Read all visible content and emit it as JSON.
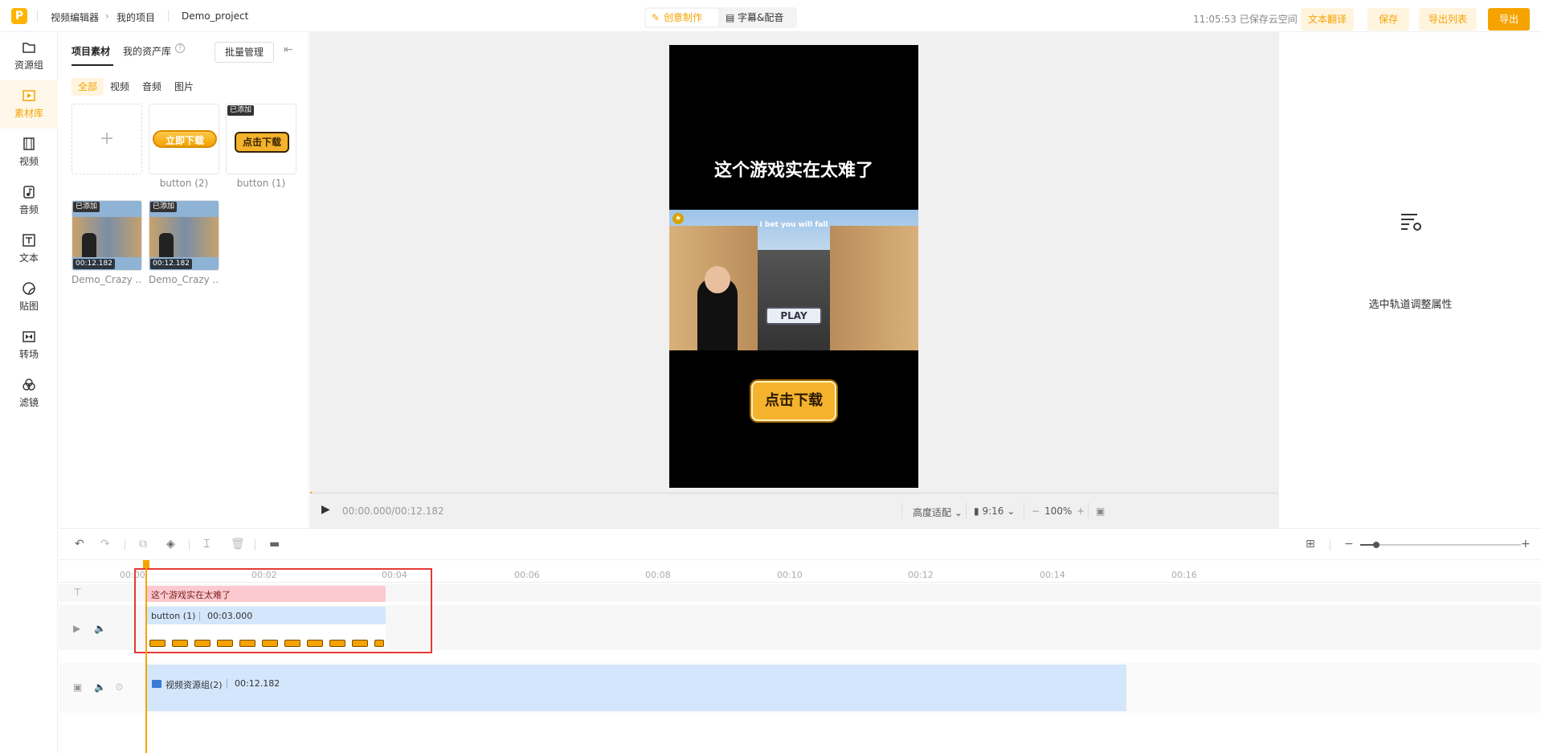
{
  "topbar": {
    "logo": "P",
    "breadcrumb": [
      "视频编辑器",
      "我的项目"
    ],
    "project_name": "Demo_project",
    "modes": [
      {
        "label": "创意制作",
        "icon": "magic-wand-icon"
      },
      {
        "label": "字幕&配音",
        "icon": "subtitle-icon"
      }
    ],
    "save_status": "11:05:53 已保存云空间",
    "buttons": {
      "translate": "文本翻译",
      "save": "保存",
      "export_list": "导出列表",
      "export": "导出"
    }
  },
  "leftnav": [
    {
      "label": "资源组",
      "icon": "folder-icon"
    },
    {
      "label": "素材库",
      "icon": "media-library-icon",
      "active": true
    },
    {
      "label": "视频",
      "icon": "film-icon"
    },
    {
      "label": "音频",
      "icon": "music-icon"
    },
    {
      "label": "文本",
      "icon": "text-icon"
    },
    {
      "label": "贴图",
      "icon": "sticker-icon"
    },
    {
      "label": "转场",
      "icon": "transition-icon"
    },
    {
      "label": "滤镜",
      "icon": "filter-icon"
    }
  ],
  "assets": {
    "tabs": [
      "项目素材",
      "我的资产库"
    ],
    "batch_label": "批量管理",
    "filters": [
      "全部",
      "视频",
      "音频",
      "图片"
    ],
    "items": [
      {
        "name": "button (2)",
        "added": false,
        "graphic_text": "立即下载"
      },
      {
        "name": "button (1)",
        "added": true,
        "badge": "已添加",
        "graphic_text": "点击下载"
      },
      {
        "name": "Demo_Crazy ...",
        "added": true,
        "badge": "已添加",
        "duration": "00:12.182"
      },
      {
        "name": "Demo_Crazy ...",
        "added": true,
        "badge": "已添加",
        "duration": "00:12.182"
      }
    ]
  },
  "preview": {
    "video_title": "这个游戏实在太难了",
    "scene_caption": "I bet you will fall",
    "play_label": "PLAY",
    "download_button": "点击下载",
    "time": "00:00.000/00:12.182",
    "fit_mode": "高度适配",
    "ratio": "9:16",
    "zoom": "100%"
  },
  "props": {
    "hint": "选中轨道调整属性",
    "icon": "settings-list-icon"
  },
  "timeline": {
    "ruler": [
      "00:00",
      "00:02",
      "00:04",
      "00:06",
      "00:08",
      "00:10",
      "00:12",
      "00:14",
      "00:16"
    ],
    "text_clip": "这个游戏实在太难了",
    "sticker_clip": {
      "name": "button (1)",
      "duration": "00:03.000"
    },
    "main_clip": {
      "name": "视频资源组(2)",
      "duration": "00:12.182"
    },
    "zoom_level": 0.1
  },
  "colors": {
    "accent": "#f5a300",
    "selection_box": "#e53935",
    "text_clip": "#fbc9cf",
    "video_clip": "#d3e6fb"
  }
}
